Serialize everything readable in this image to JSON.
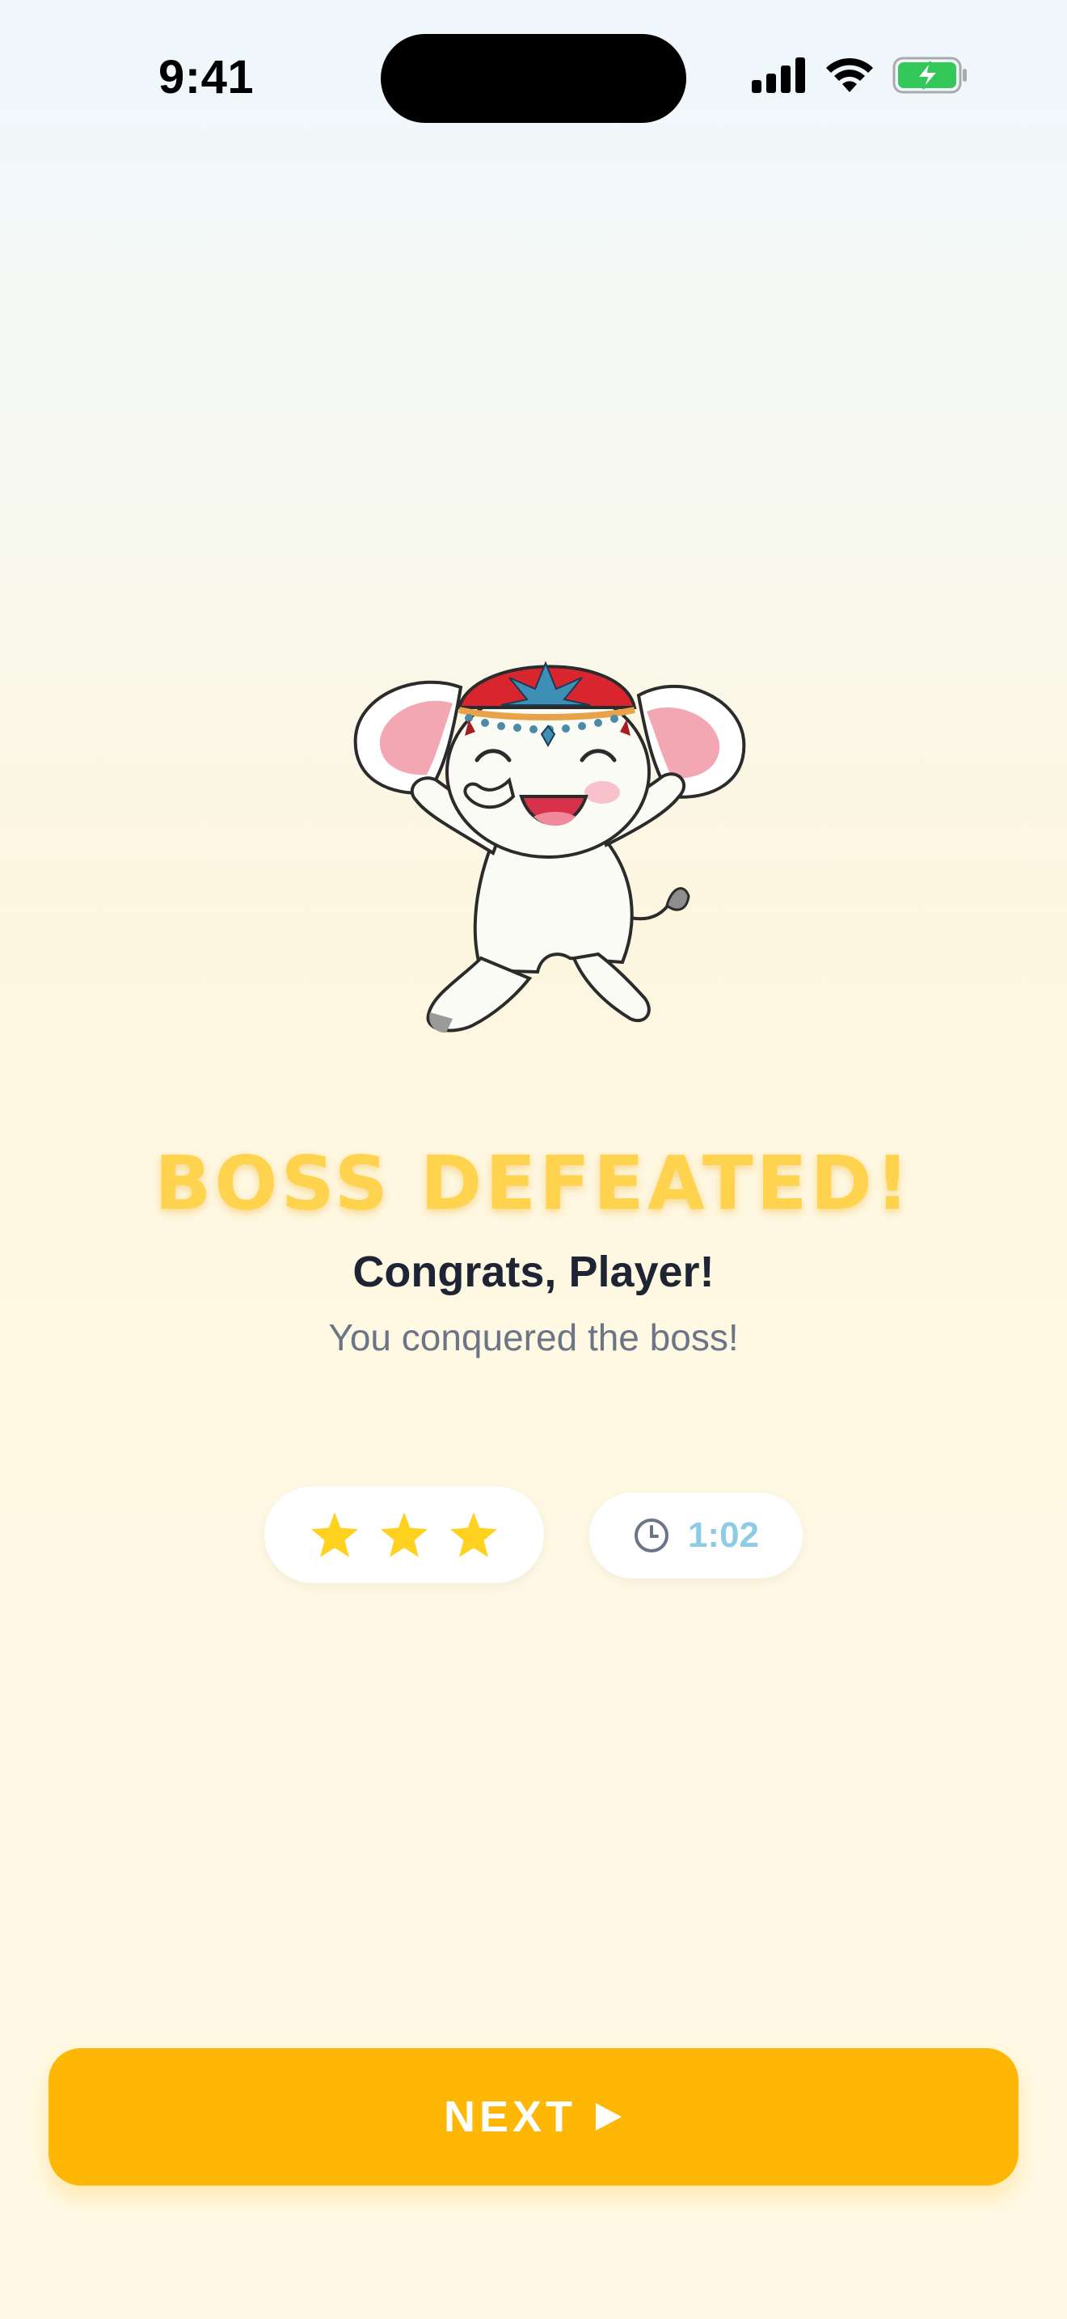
{
  "status_bar": {
    "time": "9:41",
    "icons": [
      "signal-icon",
      "wifi-icon",
      "battery-charging-icon"
    ]
  },
  "result": {
    "headline": "BOSS DEFEATED!",
    "greeting": "Congrats, Player!",
    "message": "You conquered the boss!"
  },
  "stats": {
    "stars_earned": 3,
    "stars_total": 3,
    "time_icon": "clock-icon",
    "time": "1:02"
  },
  "actions": {
    "next_label": "NEXT",
    "next_icon": "play-triangle-icon"
  },
  "colors": {
    "accent": "#ffb705",
    "headline": "#ffd34d",
    "star": "#ffd21f",
    "time": "#8ecbe4",
    "battery": "#34c759"
  },
  "mascot": "elephant-mascot"
}
